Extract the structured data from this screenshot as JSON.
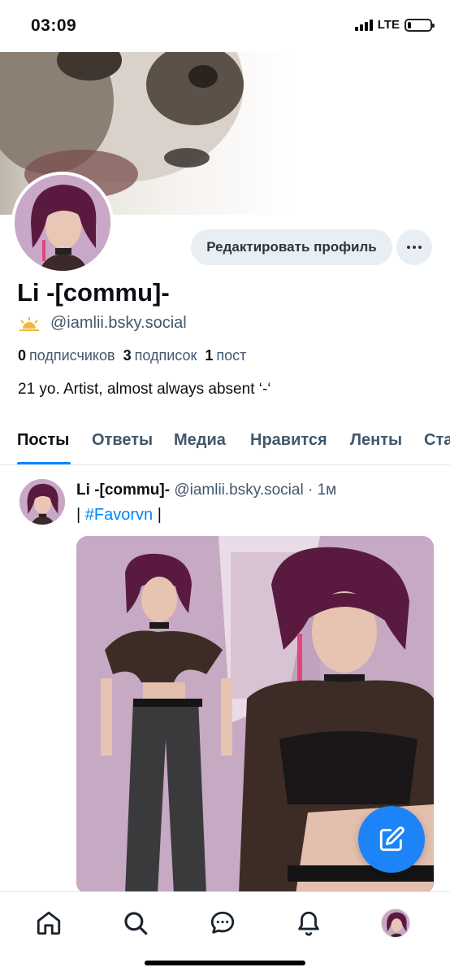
{
  "status_bar": {
    "time": "03:09",
    "network": "LTE",
    "battery_level": 0.15
  },
  "profile": {
    "display_name": "Li -[commu]-",
    "handle": "@iamlii.bsky.social",
    "edit_button_label": "Редактировать профиль",
    "stats": {
      "followers_count": "0",
      "followers_label": "подписчиков",
      "following_count": "3",
      "following_label": "подписок",
      "posts_count": "1",
      "posts_label": "пост"
    },
    "bio": "21 yo. Artist, almost always absent ‘-‘"
  },
  "tabs": [
    {
      "label": "Посты",
      "active": true
    },
    {
      "label": "Ответы"
    },
    {
      "label": "Медиа"
    },
    {
      "label": "Нравится"
    },
    {
      "label": "Ленты"
    },
    {
      "label": "Ста"
    }
  ],
  "post": {
    "author": "Li -[commu]-",
    "handle": "@iamlii.bsky.social",
    "time": "· 1м",
    "text_prefix": "| ",
    "hashtag": "#Favorvn",
    "text_suffix": " |"
  },
  "bottom_nav": [
    "home-icon",
    "search-icon",
    "chat-icon",
    "bell-icon",
    "profile-avatar"
  ],
  "colors": {
    "accent": "#0085ff",
    "fab": "#1c84f7",
    "muted_text": "#42576c"
  }
}
